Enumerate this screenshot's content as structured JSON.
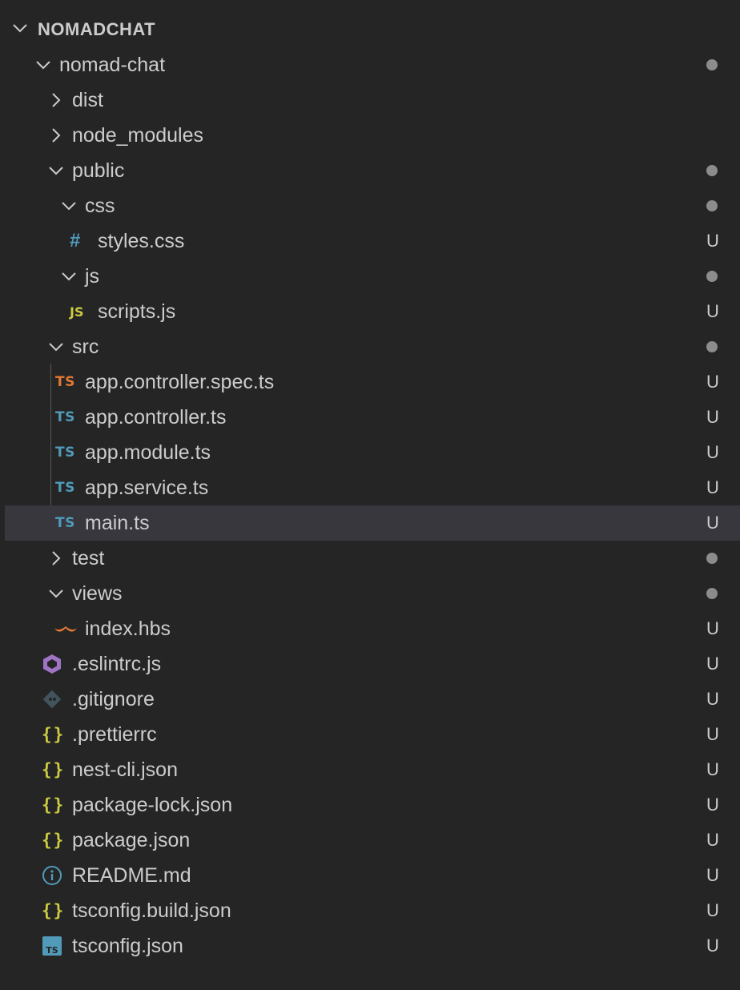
{
  "explorer": {
    "title": "NOMADCHAT",
    "items": [
      {
        "name": "nomad-chat",
        "type": "folder-open",
        "status": "dot"
      },
      {
        "name": "dist",
        "type": "folder-closed",
        "status": ""
      },
      {
        "name": "node_modules",
        "type": "folder-closed",
        "status": ""
      },
      {
        "name": "public",
        "type": "folder-open",
        "status": "dot"
      },
      {
        "name": "css",
        "type": "folder-open",
        "status": "dot"
      },
      {
        "name": "styles.css",
        "type": "file",
        "icon": "css-hash-icon",
        "status": "U"
      },
      {
        "name": "js",
        "type": "folder-open",
        "status": "dot"
      },
      {
        "name": "scripts.js",
        "type": "file",
        "icon": "js-icon",
        "status": "U"
      },
      {
        "name": "src",
        "type": "folder-open",
        "status": "dot"
      },
      {
        "name": "app.controller.spec.ts",
        "type": "file",
        "icon": "ts-spec-icon",
        "status": "U"
      },
      {
        "name": "app.controller.ts",
        "type": "file",
        "icon": "ts-icon",
        "status": "U"
      },
      {
        "name": "app.module.ts",
        "type": "file",
        "icon": "ts-icon",
        "status": "U"
      },
      {
        "name": "app.service.ts",
        "type": "file",
        "icon": "ts-icon",
        "status": "U"
      },
      {
        "name": "main.ts",
        "type": "file",
        "icon": "ts-icon",
        "status": "U",
        "selected": true
      },
      {
        "name": "test",
        "type": "folder-closed",
        "status": "dot"
      },
      {
        "name": "views",
        "type": "folder-open",
        "status": "dot"
      },
      {
        "name": "index.hbs",
        "type": "file",
        "icon": "handlebars-icon",
        "status": "U"
      },
      {
        "name": ".eslintrc.js",
        "type": "file",
        "icon": "eslint-icon",
        "status": "U"
      },
      {
        "name": ".gitignore",
        "type": "file",
        "icon": "git-icon",
        "status": "U"
      },
      {
        "name": ".prettierrc",
        "type": "file",
        "icon": "json-braces-icon",
        "status": "U"
      },
      {
        "name": "nest-cli.json",
        "type": "file",
        "icon": "json-braces-icon",
        "status": "U"
      },
      {
        "name": "package-lock.json",
        "type": "file",
        "icon": "json-braces-icon",
        "status": "U"
      },
      {
        "name": "package.json",
        "type": "file",
        "icon": "json-braces-icon",
        "status": "U"
      },
      {
        "name": "README.md",
        "type": "file",
        "icon": "info-icon",
        "status": "U"
      },
      {
        "name": "tsconfig.build.json",
        "type": "file",
        "icon": "json-braces-icon",
        "status": "U"
      },
      {
        "name": "tsconfig.json",
        "type": "file",
        "icon": "tsconfig-icon",
        "status": "U"
      }
    ]
  },
  "icon_text": {
    "ts": "TS",
    "js": "JS",
    "hash": "#",
    "braces": "{}"
  },
  "colors": {
    "background": "#252526",
    "selected_row": "#37373d",
    "text": "#cccccc",
    "ts_blue": "#519aba",
    "ts_spec_orange": "#e37933",
    "js_yellow": "#cbcb41",
    "json_yellow": "#cbcb41",
    "eslint_purple": "#a074c4",
    "handlebars_orange": "#f55385",
    "git_gray": "#41535b",
    "info_blue": "#519aba",
    "modified_dot": "#8c8c8c"
  }
}
